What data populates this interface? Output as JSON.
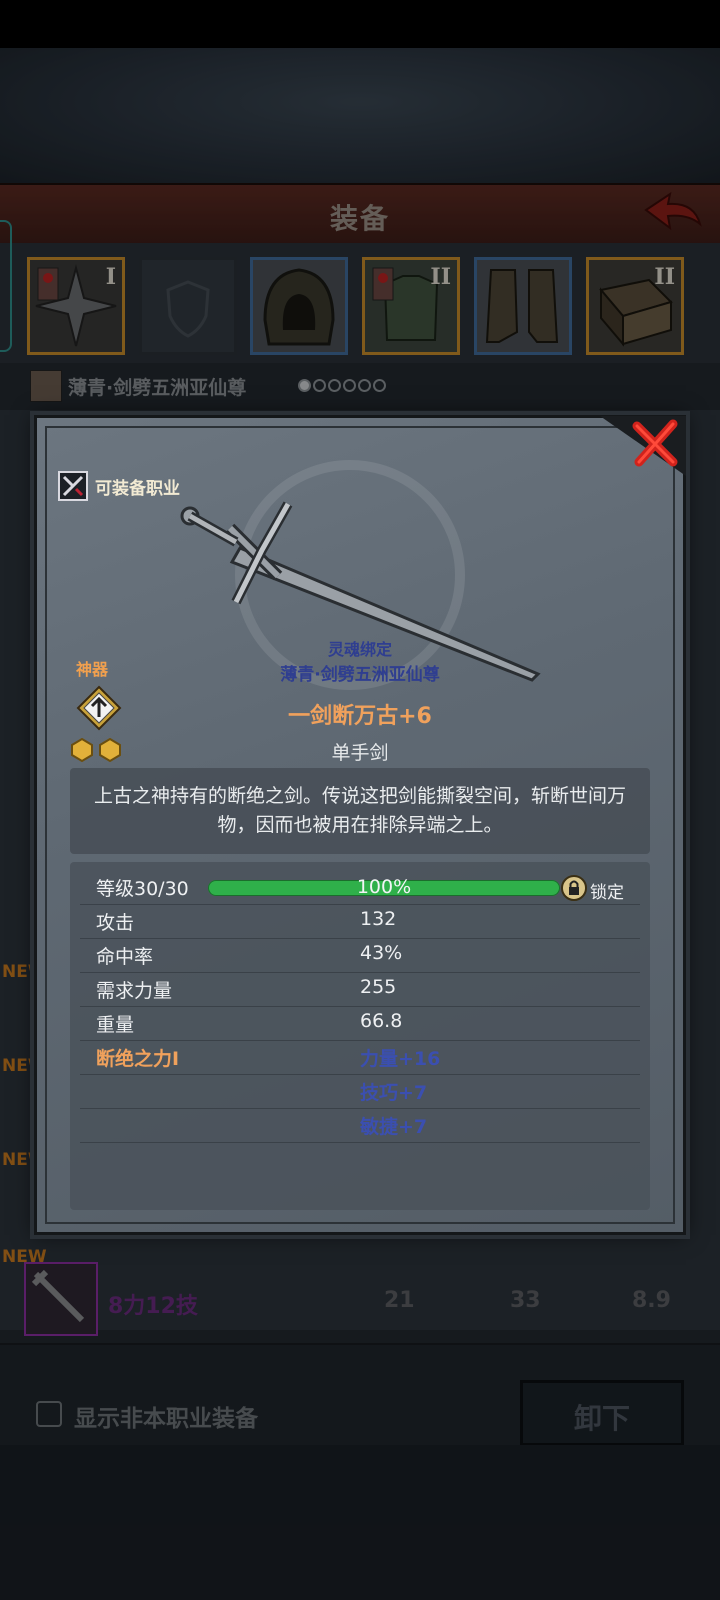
{
  "header": {
    "title": "装备"
  },
  "slots": [
    {
      "roman": "I"
    },
    {
      "roman": ""
    },
    {
      "roman": ""
    },
    {
      "roman": "II"
    },
    {
      "roman": ""
    },
    {
      "roman": "II"
    }
  ],
  "character": {
    "name": "薄青·剑劈五洲亚仙尊"
  },
  "background_list": {
    "new_label": "NEW",
    "row": {
      "name": "8力12技",
      "c1": "21",
      "c2": "33",
      "c3": "8.9"
    }
  },
  "bottom": {
    "checkbox_label": "显示非本职业装备",
    "unequip_label": "卸下"
  },
  "popup": {
    "class_label": "可装备职业",
    "artifact_label": "神器",
    "soulbound_label": "灵魂绑定",
    "soulbound_owner": "薄青·剑劈五洲亚仙尊",
    "item_name": "一剑断万古+6",
    "item_type": "单手剑",
    "description": "上古之神持有的断绝之剑。传说这把剑能撕裂空间，斩断世间万物，因而也被用在排除异端之上。",
    "level": {
      "label": "等级30/30",
      "percent_text": "100%",
      "progress": 1.0,
      "lock_label": "锁定"
    },
    "stats": [
      {
        "label": "攻击",
        "value": "132"
      },
      {
        "label": "命中率",
        "value": "43%"
      },
      {
        "label": "需求力量",
        "value": "255"
      },
      {
        "label": "重量",
        "value": "66.8"
      }
    ],
    "bonus": {
      "label": "断绝之力I",
      "values": [
        "力量+16",
        "技巧+7",
        "敏捷+7"
      ]
    }
  }
}
